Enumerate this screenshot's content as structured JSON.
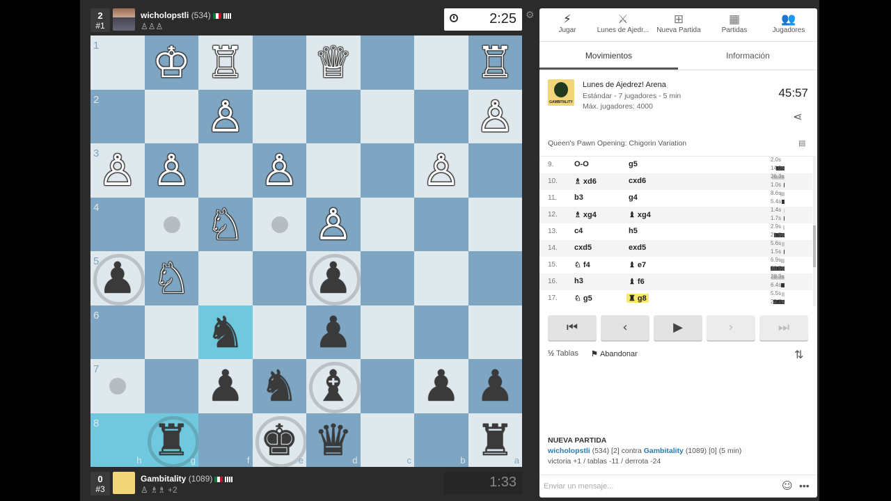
{
  "top_player": {
    "rank": "2",
    "pos": "#1",
    "name": "wicholopstli",
    "rating": "(534)",
    "caps": "♙♙♙",
    "clock": "2:25"
  },
  "bottom_player": {
    "rank": "0",
    "pos": "#3",
    "name": "Gambitality",
    "rating": "(1089)",
    "caps": "♙ ♗♗",
    "extra": "+2",
    "clock": "1:33"
  },
  "colors": {
    "light": "#dfe8ec",
    "dark": "#7ea6c3",
    "highlight": "#6fc8dd",
    "active_move": "#f5e96a"
  },
  "board": {
    "rank_labels": [
      "1",
      "2",
      "3",
      "4",
      "5",
      "6",
      "7",
      "8"
    ],
    "file_labels": [
      "h",
      "g",
      "f",
      "e",
      "d",
      "c",
      "b",
      "a"
    ],
    "pieces": {
      "wk1": "♔",
      "wr1": "♖",
      "wq1": "♕",
      "wr2": "♖",
      "wp1": "♙",
      "wp2": "♙",
      "wp3": "♙",
      "wp4": "♙",
      "wp5": "♙",
      "wp6": "♙",
      "wn1": "♘",
      "wp7": "♙",
      "bp1": "♟",
      "wn2": "♘",
      "bp2": "♟",
      "bn1": "♞",
      "bp3": "♟",
      "bp4": "♟",
      "bn2": "♞",
      "bb1": "♝",
      "bp5": "♟",
      "bp6": "♟",
      "br1": "♜",
      "bk1": "♚",
      "bq1": "♛",
      "br2": "♜"
    }
  },
  "nav": [
    {
      "icon": "⚡",
      "label": "Jugar"
    },
    {
      "icon": "⚔",
      "label": "Lunes de Ajedr..."
    },
    {
      "icon": "⊞",
      "label": "Nueva Partida"
    },
    {
      "icon": "▦",
      "label": "Partidas"
    },
    {
      "icon": "👥",
      "label": "Jugadores"
    }
  ],
  "tabs": {
    "moves": "Movimientos",
    "info": "Información"
  },
  "tournament": {
    "logo_text": "GAMBITALITY",
    "name": "Lunes de Ajedrez! Arena",
    "meta1": "Estándar - 7 jugadores - 5 min",
    "meta2": "Máx. jugadores: 4000",
    "time": "45:57"
  },
  "opening": "Queen's Pawn Opening: Chigorin Variation",
  "moves": [
    {
      "n": "9.",
      "w": "O-O",
      "b": "g5",
      "tw": "2.0s",
      "tb": "14.0s",
      "pw": 0,
      "pb": 12
    },
    {
      "n": "10.",
      "w": "♗ xd6",
      "b": "cxd6",
      "tw": "26.3s",
      "tb": "1.0s",
      "pw": 18,
      "pb": 1
    },
    {
      "n": "11.",
      "w": "b3",
      "b": "g4",
      "tw": "8.6s",
      "tb": "5.4s",
      "pw": 6,
      "pb": 4
    },
    {
      "n": "12.",
      "w": "♗ xg4",
      "b": "♝ xg4",
      "tw": "1.4s",
      "tb": "1.7s",
      "pw": 1,
      "pb": 1
    },
    {
      "n": "13.",
      "w": "c4",
      "b": "h5",
      "tw": "2.9s",
      "tb": "21.5s",
      "pw": 2,
      "pb": 15
    },
    {
      "n": "14.",
      "w": "cxd5",
      "b": "exd5",
      "tw": "5.6s",
      "tb": "1.5s",
      "pw": 4,
      "pb": 1
    },
    {
      "n": "15.",
      "w": "♘ f4",
      "b": "♝ e7",
      "tw": "6.9s",
      "tb": "30.5s",
      "pw": 5,
      "pb": 20
    },
    {
      "n": "16.",
      "w": "h3",
      "b": "♝ f6",
      "tw": "28.3s",
      "tb": "6.4s",
      "pw": 19,
      "pb": 5
    },
    {
      "n": "17.",
      "w": "♘ g5",
      "b": "♜ g8",
      "tw": "5.5s",
      "tb": "22.7s",
      "pw": 4,
      "pb": 16
    }
  ],
  "controls": {
    "first": "⏮",
    "prev": "‹",
    "play": "▶",
    "next": "›",
    "last": "⏭"
  },
  "actions": {
    "draw_icon": "½",
    "draw": "Tablas",
    "resign_icon": "⚑",
    "resign": "Abandonar",
    "flip": "⇅"
  },
  "new_game": {
    "title": "NUEVA PARTIDA",
    "white": "wicholopstli",
    "white_info": "(534) [2] contra",
    "black": "Gambitality",
    "black_info": "(1089) [0] (5 min)",
    "result": "victoria +1 / tablas -11 / derrota -24"
  },
  "chat": {
    "placeholder": "Enviar un mensaje...",
    "emoji": "☺",
    "more": "•••"
  },
  "misc": {
    "gear": "⚙",
    "share": "⋖",
    "book": "▤"
  }
}
